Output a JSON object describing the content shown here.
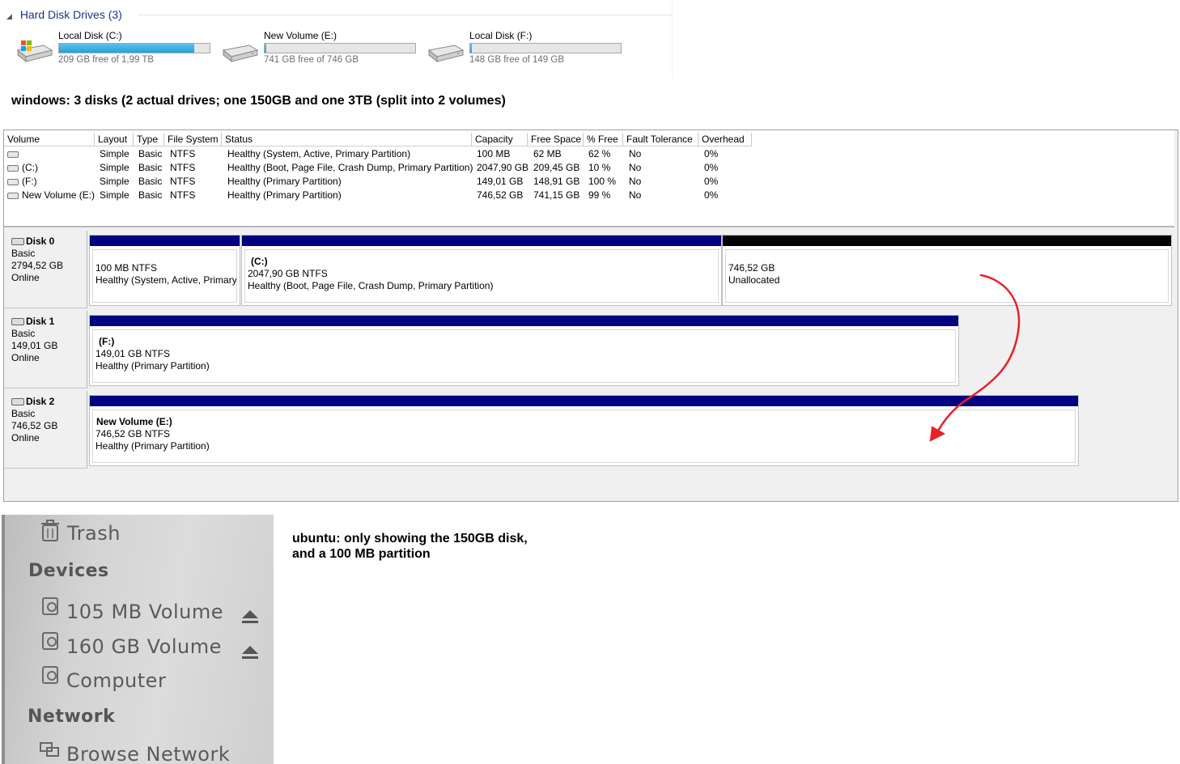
{
  "explorer": {
    "group_title": "Hard Disk Drives (3)",
    "drives": [
      {
        "name": "Local Disk (C:)",
        "free_text": "209 GB free of 1,99 TB",
        "used_fraction": 0.9
      },
      {
        "name": "New Volume (E:)",
        "free_text": "741 GB free of 746 GB",
        "used_fraction": 0.007
      },
      {
        "name": "Local Disk (F:)",
        "free_text": "148 GB free of 149 GB",
        "used_fraction": 0.007
      }
    ]
  },
  "captions": {
    "windows": "windows: 3 disks (2 actual drives; one 150GB and one 3TB (split into 2 volumes)",
    "ubuntu_line1": "ubuntu: only showing the 150GB disk,",
    "ubuntu_line2": "and a 100 MB partition"
  },
  "volume_table": {
    "columns": [
      "Volume",
      "Layout",
      "Type",
      "File System",
      "Status",
      "Capacity",
      "Free Space",
      "% Free",
      "Fault Tolerance",
      "Overhead"
    ],
    "rows": [
      {
        "volume": "",
        "layout": "Simple",
        "type": "Basic",
        "fs": "NTFS",
        "status": "Healthy (System, Active, Primary Partition)",
        "capacity": "100 MB",
        "free": "62 MB",
        "pct": "62 %",
        "fault": "No",
        "overhead": "0%"
      },
      {
        "volume": "(C:)",
        "layout": "Simple",
        "type": "Basic",
        "fs": "NTFS",
        "status": "Healthy (Boot, Page File, Crash Dump, Primary Partition)",
        "capacity": "2047,90 GB",
        "free": "209,45 GB",
        "pct": "10 %",
        "fault": "No",
        "overhead": "0%"
      },
      {
        "volume": "(F:)",
        "layout": "Simple",
        "type": "Basic",
        "fs": "NTFS",
        "status": "Healthy (Primary Partition)",
        "capacity": "149,01 GB",
        "free": "148,91 GB",
        "pct": "100 %",
        "fault": "No",
        "overhead": "0%"
      },
      {
        "volume": "New Volume (E:)",
        "layout": "Simple",
        "type": "Basic",
        "fs": "NTFS",
        "status": "Healthy (Primary Partition)",
        "capacity": "746,52 GB",
        "free": "741,15 GB",
        "pct": "99 %",
        "fault": "No",
        "overhead": "0%"
      }
    ]
  },
  "disks": [
    {
      "name": "Disk 0",
      "type": "Basic",
      "size": "2794,52 GB",
      "status": "Online",
      "partitions": [
        {
          "title": "",
          "size": "100 MB NTFS",
          "status": "Healthy (System, Active, Primary"
        },
        {
          "title": "(C:)",
          "size": "2047,90 GB NTFS",
          "status": "Healthy (Boot, Page File, Crash Dump, Primary Partition)"
        },
        {
          "title": "",
          "size": "746,52 GB",
          "status": "Unallocated"
        }
      ]
    },
    {
      "name": "Disk 1",
      "type": "Basic",
      "size": "149,01 GB",
      "status": "Online",
      "partitions": [
        {
          "title": "(F:)",
          "size": "149,01 GB NTFS",
          "status": "Healthy (Primary Partition)"
        }
      ]
    },
    {
      "name": "Disk 2",
      "type": "Basic",
      "size": "746,52 GB",
      "status": "Online",
      "partitions": [
        {
          "title": "New Volume  (E:)",
          "size": "746,52 GB NTFS",
          "status": "Healthy (Primary Partition)"
        }
      ]
    }
  ],
  "annotation": {
    "arrow_color": "#e8202a"
  },
  "ubuntu": {
    "trash": "Trash",
    "devices_heading": "Devices",
    "devices": [
      "105 MB Volume",
      "160 GB Volume",
      "Computer"
    ],
    "network_heading": "Network",
    "browse_network": "Browse Network"
  },
  "colors": {
    "partition_header": "#000080",
    "unallocated_header": "#000000",
    "progress_fill": "#26a0da"
  }
}
